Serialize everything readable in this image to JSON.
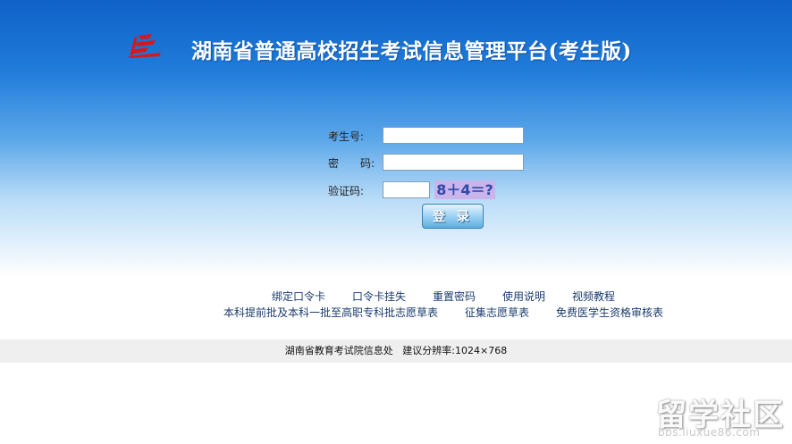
{
  "header": {
    "title": "湖南省普通高校招生考试信息管理平台(考生版)",
    "logo_icon": "red-flame-logo-icon"
  },
  "form": {
    "student_id_label": "考生号:",
    "password_label": "密　　码:",
    "captcha_label": "验证码:",
    "student_id_value": "",
    "password_value": "",
    "captcha_value": "",
    "captcha_image_text": "8＋4＝?",
    "login_button": "登 录"
  },
  "links": {
    "row1": [
      "绑定口令卡",
      "口令卡挂失",
      "重置密码",
      "使用说明",
      "视频教程"
    ],
    "row2": [
      "本科提前批及本科一批至高职专科批志愿草表",
      "征集志愿草表",
      "免费医学生资格审核表"
    ]
  },
  "footer": {
    "org": "湖南省教育考试院信息处",
    "resolution": "建议分辨率:1024×768"
  },
  "watermark": {
    "text": "留学社区",
    "url": "bbs.liuxue86.com"
  },
  "colors": {
    "header_blue": "#1062c8",
    "logo_red": "#d8171c",
    "captcha_bg": "#c9b4ec",
    "link": "#1a3c6e"
  }
}
